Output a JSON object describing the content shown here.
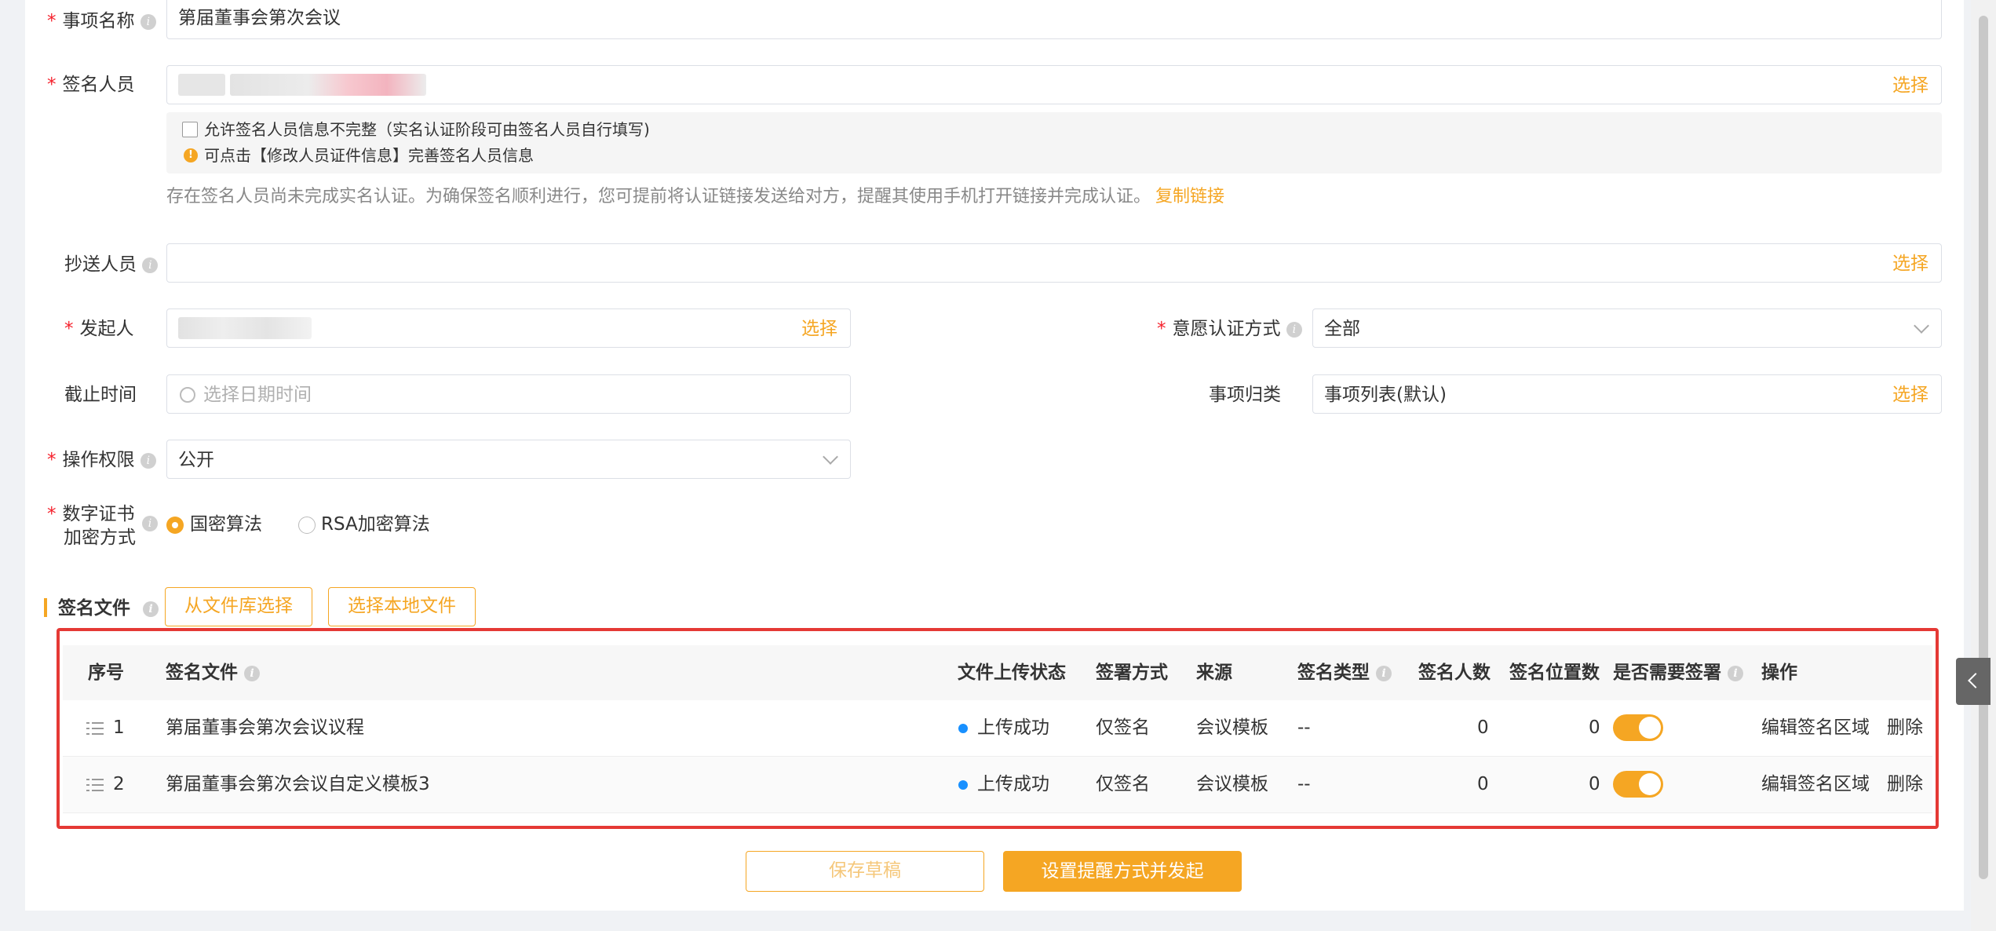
{
  "form": {
    "event_name": {
      "label": "事项名称",
      "value": "第届董事会第次会议"
    },
    "signers": {
      "label": "签名人员",
      "select_label": "选择",
      "allow_incomplete": "允许签名人员信息不完整（实名认证阶段可由签名人员自行填写)",
      "hint": "可点击【修改人员证件信息】完善签名人员信息",
      "notice": "存在签名人员尚未完成实名认证。为确保签名顺利进行，您可提前将认证链接发送给对方，提醒其使用手机打开链接并完成认证。",
      "copy_link": "复制链接"
    },
    "cc": {
      "label": "抄送人员",
      "select_label": "选择"
    },
    "initiator": {
      "label": "发起人",
      "select_label": "选择"
    },
    "intent_auth": {
      "label": "意愿认证方式",
      "value": "全部"
    },
    "deadline": {
      "label": "截止时间",
      "placeholder": "选择日期时间"
    },
    "category": {
      "label": "事项归类",
      "value": "事项列表(默认)",
      "select_label": "选择"
    },
    "permission": {
      "label": "操作权限",
      "value": "公开"
    },
    "cert": {
      "label_line1": "数字证书",
      "label_line2": "加密方式",
      "option_gm": "国密算法",
      "option_rsa": "RSA加密算法"
    }
  },
  "files": {
    "label": "签名文件",
    "from_library": "从文件库选择",
    "local_file": "选择本地文件",
    "headers": {
      "index": "序号",
      "file": "签名文件",
      "upload_status": "文件上传状态",
      "sign_method": "签署方式",
      "source": "来源",
      "sign_type": "签名类型",
      "signer_count": "签名人数",
      "position_count": "签名位置数",
      "need_sign": "是否需要签署",
      "actions": "操作"
    },
    "rows": [
      {
        "index": "1",
        "file": "第届董事会第次会议议程",
        "upload_status": "上传成功",
        "sign_method": "仅签名",
        "source": "会议模板",
        "sign_type": "--",
        "signer_count": "0",
        "position_count": "0",
        "edit": "编辑签名区域",
        "delete": "删除"
      },
      {
        "index": "2",
        "file": "第届董事会第次会议自定义模板3",
        "upload_status": "上传成功",
        "sign_method": "仅签名",
        "source": "会议模板",
        "sign_type": "--",
        "signer_count": "0",
        "position_count": "0",
        "edit": "编辑签名区域",
        "delete": "删除"
      }
    ]
  },
  "footer": {
    "save_draft": "保存草稿",
    "submit": "设置提醒方式并发起"
  },
  "colors": {
    "accent": "#f5a623",
    "highlight_border": "#e53935",
    "status_dot": "#1890ff"
  }
}
